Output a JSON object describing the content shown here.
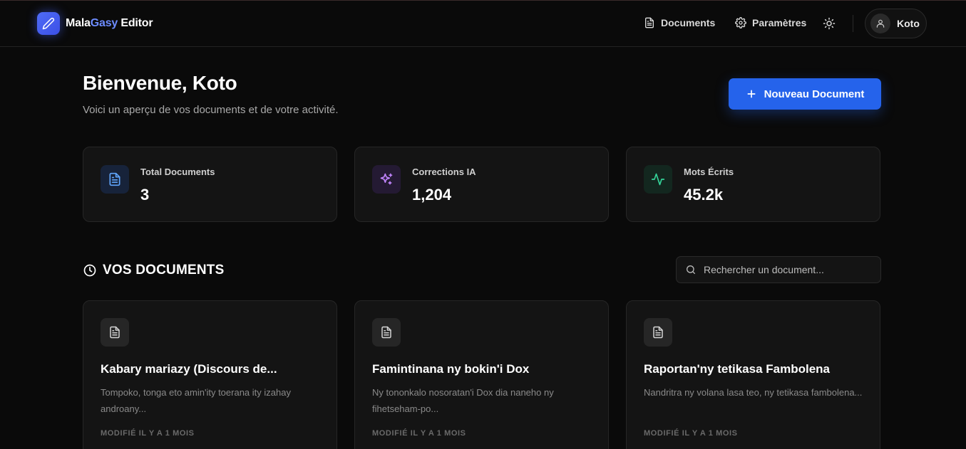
{
  "app": {
    "brand_part1": "Mala",
    "brand_part2": "Gasy",
    "brand_part3": " Editor",
    "accent_color": "#2563eb",
    "brand_gradient": [
      "#4f6cf7",
      "#3b4fe6"
    ]
  },
  "nav": {
    "documents_label": "Documents",
    "settings_label": "Paramètres",
    "theme_icon": "sun-icon",
    "user_name": "Koto"
  },
  "hero": {
    "title": "Bienvenue, Koto",
    "subtitle": "Voici un aperçu de vos documents et de votre activité.",
    "new_doc_label": "Nouveau Document"
  },
  "stats": [
    {
      "label": "Total Documents",
      "value": "3",
      "icon": "file-text-icon",
      "color": "#60a5fa"
    },
    {
      "label": "Corrections IA",
      "value": "1,204",
      "icon": "sparkles-icon",
      "color": "#c084fc"
    },
    {
      "label": "Mots Écrits",
      "value": "45.2k",
      "icon": "activity-icon",
      "color": "#34d399"
    }
  ],
  "documents_section": {
    "title": "VOS DOCUMENTS",
    "search_placeholder": "Rechercher un document..."
  },
  "documents": [
    {
      "title": "Kabary mariazy (Discours de...",
      "excerpt": "Tompoko, tonga eto amin'ity toerana ity izahay androany...",
      "meta": "MODIFIÉ IL Y A 1 MOIS"
    },
    {
      "title": "Famintinana ny bokin'i Dox",
      "excerpt": "Ny tononkalo nosoratan'i Dox dia naneho ny fihetseham-po...",
      "meta": "MODIFIÉ IL Y A 1 MOIS"
    },
    {
      "title": "Raportan'ny tetikasa Fambolena",
      "excerpt": "Nandritra ny volana lasa teo, ny tetikasa fambolena...",
      "meta": "MODIFIÉ IL Y A 1 MOIS"
    }
  ]
}
